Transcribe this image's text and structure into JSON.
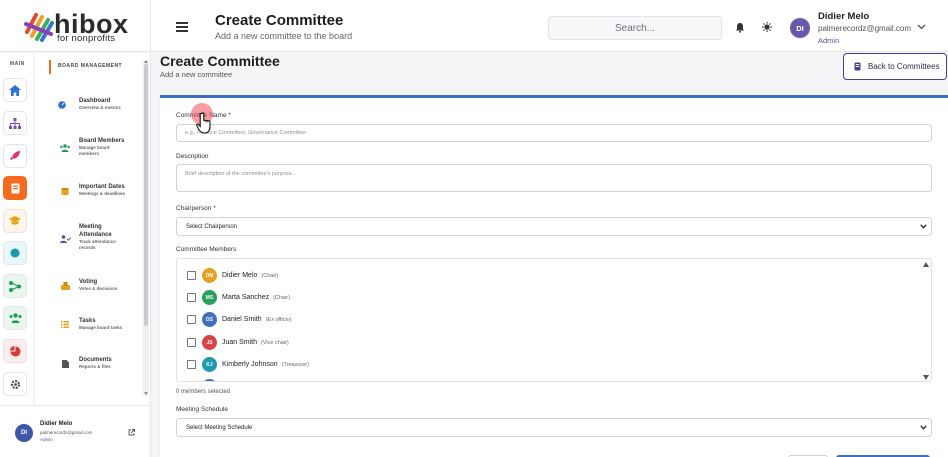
{
  "logo": {
    "brand": "hibox",
    "tagline": "for nonprofits"
  },
  "header": {
    "title": "Create Committee",
    "subtitle": "Add a new committee to the board",
    "search_placeholder": "Search...",
    "user": {
      "initials": "DI",
      "name": "Didier Melo",
      "email": "palmerecordz@gmail.com",
      "role": "Admin"
    }
  },
  "rail": {
    "label": "MAIN",
    "items": [
      {
        "icon": "home-icon",
        "color": "#2f6fd6"
      },
      {
        "icon": "org-chart-icon",
        "color": "#7a4fc0"
      },
      {
        "icon": "rocket-icon",
        "color": "#d9397a"
      },
      {
        "icon": "board-icon",
        "color": "#ffffff",
        "active_bg": "#f46b1f"
      },
      {
        "icon": "graduation-icon",
        "color": "#e2a21a"
      },
      {
        "icon": "circle-icon",
        "color": "#1a9bb0"
      },
      {
        "icon": "share-icon",
        "color": "#1f9a5a"
      },
      {
        "icon": "users-icon",
        "color": "#1f9a5a"
      },
      {
        "icon": "pie-icon",
        "color": "#d63a3a"
      },
      {
        "icon": "gear-icon",
        "color": "#555555"
      }
    ]
  },
  "nav": {
    "heading": "BOARD MANAGEMENT",
    "items": [
      {
        "title": "Dashboard",
        "desc": "Overview & metrics",
        "icon_color": "#2f6fd6"
      },
      {
        "title": "Board Members",
        "desc": "Manage board members",
        "icon_color": "#1f9a5a"
      },
      {
        "title": "Important Dates",
        "desc": "Meetings & deadlines",
        "icon_color": "#e2a21a"
      },
      {
        "title": "Meeting Attendance",
        "desc": "Track attendance records",
        "icon_color": "#5b4fa6"
      },
      {
        "title": "Voting",
        "desc": "Votes & decisions",
        "icon_color": "#e2a21a"
      },
      {
        "title": "Tasks",
        "desc": "Manage board tasks",
        "icon_color": "#e2a21a"
      },
      {
        "title": "Documents",
        "desc": "Reports & files",
        "icon_color": "#555555"
      }
    ]
  },
  "footer_user": {
    "initials": "DI",
    "name": "Didier Melo",
    "email": "palmerecordz@gmail.com",
    "role": "Admin"
  },
  "page": {
    "title": "Create Committee",
    "subtitle": "Add a new committee",
    "back_label": "Back to Committees"
  },
  "form": {
    "name_label": "Committee Name *",
    "name_placeholder": "e.g., Finance Committee, Governance Committee",
    "desc_label": "Description",
    "desc_placeholder": "Brief description of the committee's purpose...",
    "chair_label": "Chairperson *",
    "chair_value": "Select Chairperson",
    "members_label": "Committee Members",
    "members": [
      {
        "initials": "DM",
        "name": "Didier Melo",
        "role": "(Chair)",
        "color": "#e8a020"
      },
      {
        "initials": "MS",
        "name": "Marta Sanchez",
        "role": "(Chair)",
        "color": "#2aa05a"
      },
      {
        "initials": "DS",
        "name": "Daniel Smith",
        "role": "(Ex officio)",
        "color": "#3f6fc0"
      },
      {
        "initials": "JS",
        "name": "Juan Smith",
        "role": "(Vice chair)",
        "color": "#d64545"
      },
      {
        "initials": "KJ",
        "name": "Kimberly Johnson",
        "role": "(Treasurer)",
        "color": "#1f9ab0"
      }
    ],
    "members_count": "0 members selected",
    "schedule_label": "Meeting Schedule",
    "schedule_value": "Select Meeting Schedule"
  }
}
